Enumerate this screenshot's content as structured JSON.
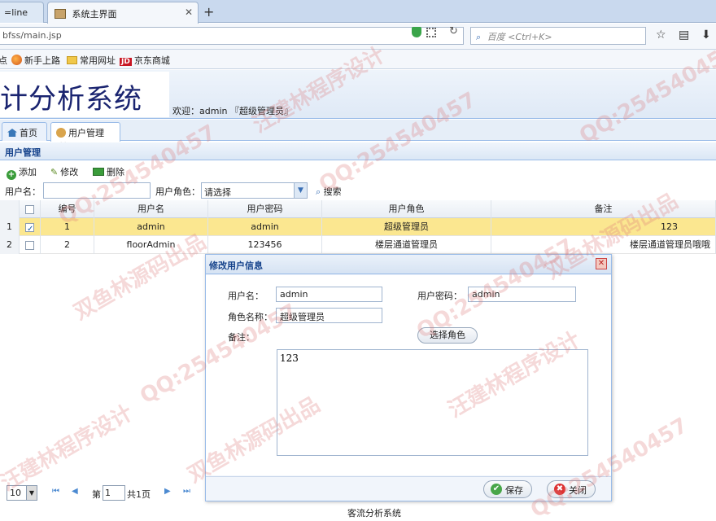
{
  "browser": {
    "tabs": [
      {
        "label": "=line"
      },
      {
        "label": "系统主界面"
      }
    ],
    "url": "bfss/main.jsp",
    "search_placeholder": "百度 <Ctrl+K>",
    "bookmarks": [
      "点",
      "新手上路",
      "常用网址",
      "京东商城"
    ]
  },
  "header": {
    "logo_text": "计分析系统",
    "welcome": "欢迎：admin 『超级管理员』"
  },
  "app_tabs": [
    {
      "label": "首页"
    },
    {
      "label": "用户管理"
    }
  ],
  "panel": {
    "title": "用户管理",
    "toolbar": {
      "add": "添加",
      "edit": "修改",
      "delete": "删除"
    },
    "filter": {
      "username_label": "用户名：",
      "username_value": "",
      "role_label": "用户角色：",
      "role_value": "请选择",
      "search": "搜索"
    }
  },
  "grid": {
    "columns": [
      "编号",
      "用户名",
      "用户密码",
      "用户角色",
      "备注"
    ],
    "rows": [
      {
        "rownum": "1",
        "checked": true,
        "id": "1",
        "username": "admin",
        "password": "admin",
        "role": "超级管理员",
        "note": "123"
      },
      {
        "rownum": "2",
        "checked": false,
        "id": "2",
        "username": "floorAdmin",
        "password": "123456",
        "role": "楼层通道管理员",
        "note": "楼层通道管理员哦哦"
      }
    ]
  },
  "dialog": {
    "title": "修改用户信息",
    "username_label": "用户名：",
    "username_value": "admin",
    "password_label": "用户密码：",
    "password_value": "admin",
    "role_label": "角色名称：",
    "role_value": "超级管理员",
    "pick_role": "选择角色",
    "note_label": "备注：",
    "note_value": "123",
    "save": "保存",
    "close": "关闭"
  },
  "pager": {
    "page_size": "10",
    "page_prefix": "第",
    "page_value": "1",
    "page_suffix": "共1页"
  },
  "footer": "客流分析系统",
  "watermarks": [
    "QQ:254540457",
    "汪建林程序设计",
    "双鱼林源码出品"
  ],
  "colors": {
    "selected_row": "#fbe790",
    "header_blue": "#15428b",
    "logo_text": "#1a2470"
  }
}
